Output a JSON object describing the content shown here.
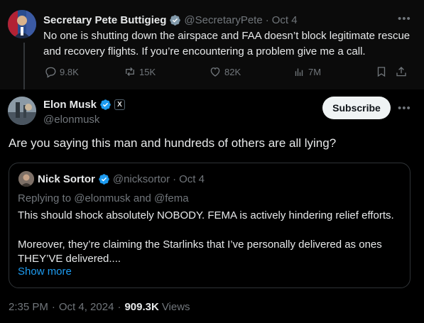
{
  "reply": {
    "name": "Secretary Pete Buttigieg",
    "handle": "@SecretaryPete",
    "separator": "·",
    "date": "Oct 4",
    "text_line1": "No one is shutting down the airspace and FAA doesn’t block legitimate rescue",
    "text_line2": "and recovery flights. If you’re encountering a problem give me a call.",
    "replies": "9.8K",
    "reposts": "15K",
    "likes": "82K",
    "views": "7M"
  },
  "main": {
    "name": "Elon Musk",
    "affiliate_badge": "X",
    "handle": "@elonmusk",
    "subscribe_label": "Subscribe",
    "text": "Are you saying this man and hundreds of others are all lying?",
    "time": "2:35 PM",
    "separator": "·",
    "date": "Oct 4, 2024",
    "views_count": "909.3K",
    "views_label": "Views"
  },
  "quote": {
    "name": "Nick Sortor",
    "handle": "@nicksortor",
    "separator": "·",
    "date": "Oct 4",
    "replying_prefix": "Replying to",
    "replying_user1": "@elonmusk",
    "replying_and": "and",
    "replying_user2": "@fema",
    "text_line1": "This should shock absolutely NOBODY. FEMA is actively hindering relief efforts.",
    "text_line2": "Moreover, they’re claiming the Starlinks that I’ve personally delivered as ones",
    "text_line3": "THEY’VE delivered....",
    "show_more": "Show more"
  },
  "colors": {
    "background": "#000000",
    "text": "#e7e9ea",
    "muted": "#71767b",
    "link": "#1d9bf0",
    "verified_gold": "#e2b719",
    "verified_blue": "#1d9bf0",
    "border": "#2f3336"
  },
  "icons": [
    "reply-icon",
    "repost-icon",
    "like-icon",
    "views-icon",
    "bookmark-icon",
    "share-icon",
    "more-icon",
    "verified-badge-icon"
  ]
}
